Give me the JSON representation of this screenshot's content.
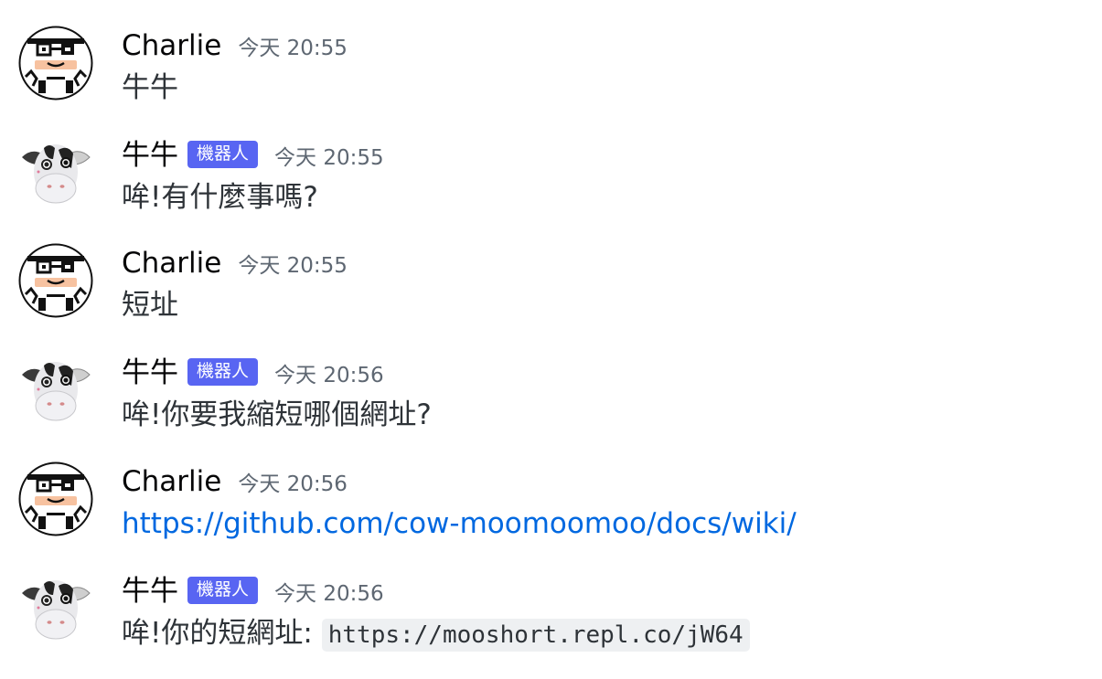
{
  "messages": [
    {
      "author": "Charlie",
      "avatar": "charlie-avatar",
      "is_bot": false,
      "badge": "",
      "timestamp": "今天 20:55",
      "text": "牛牛"
    },
    {
      "author": "牛牛",
      "avatar": "cow-avatar",
      "is_bot": true,
      "badge": "機器人",
      "timestamp": "今天 20:55",
      "text": "哞!有什麼事嗎?"
    },
    {
      "author": "Charlie",
      "avatar": "charlie-avatar",
      "is_bot": false,
      "badge": "",
      "timestamp": "今天 20:55",
      "text": "短址"
    },
    {
      "author": "牛牛",
      "avatar": "cow-avatar",
      "is_bot": true,
      "badge": "機器人",
      "timestamp": "今天 20:56",
      "text": "哞!你要我縮短哪個網址?"
    },
    {
      "author": "Charlie",
      "avatar": "charlie-avatar",
      "is_bot": false,
      "badge": "",
      "timestamp": "今天 20:56",
      "link": "https://github.com/cow-moomoomoo/docs/wiki/"
    },
    {
      "author": "牛牛",
      "avatar": "cow-avatar",
      "is_bot": true,
      "badge": "機器人",
      "timestamp": "今天 20:56",
      "text": "哞!你的短網址: ",
      "code": "https://mooshort.repl.co/jW64"
    }
  ],
  "colors": {
    "bot_badge": "#5865f2",
    "link": "#0068e0",
    "timestamp": "#5e6772",
    "code_bg": "#eef0f2"
  }
}
